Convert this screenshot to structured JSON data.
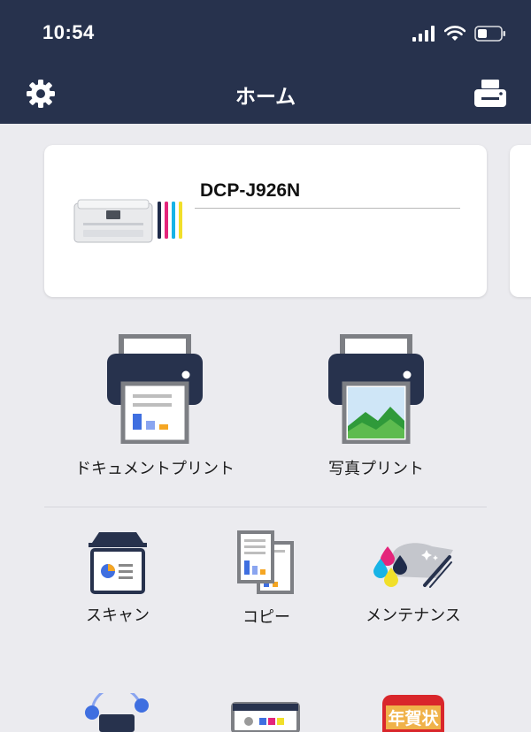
{
  "status_bar": {
    "time": "10:54",
    "icons": [
      "signal-icon",
      "wifi-icon",
      "battery-icon"
    ]
  },
  "nav": {
    "title": "ホーム",
    "left_icon": "gear-icon",
    "right_icon": "printer-icon"
  },
  "device_card": {
    "model": "DCP-J926N",
    "ink_colors": [
      "#1f2b4a",
      "#e4257b",
      "#17b3e6",
      "#f1df2a"
    ]
  },
  "main_functions": [
    {
      "label": "ドキュメントプリント",
      "icon": "document-print-icon"
    },
    {
      "label": "写真プリント",
      "icon": "photo-print-icon"
    }
  ],
  "sub_functions": [
    {
      "label": "スキャン",
      "icon": "scanner-icon"
    },
    {
      "label": "コピー",
      "icon": "copy-icon"
    },
    {
      "label": "メンテナンス",
      "icon": "maintenance-icon"
    }
  ],
  "bottom_row": {
    "nengajo_badge": "年賀状"
  },
  "colors": {
    "header_bg": "#27324d",
    "page_bg": "#ebebef",
    "accent_blue": "#3f6fe0",
    "accent_orange": "#f5a623",
    "nengajo_red": "#d9262b"
  }
}
